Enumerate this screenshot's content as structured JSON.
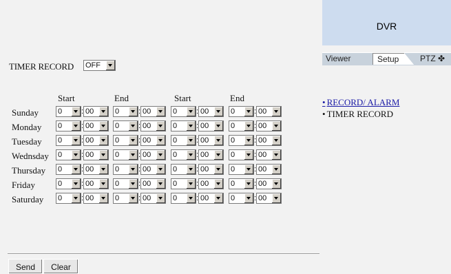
{
  "timer_record": {
    "label": "TIMER RECORD",
    "value": "OFF"
  },
  "headers": [
    "Start",
    "End",
    "Start",
    "End"
  ],
  "days": [
    "Sunday",
    "Monday",
    "Tuesday",
    "Wednsday",
    "Thursday",
    "Friday",
    "Saturday"
  ],
  "default_hour": "0",
  "default_minute": "00",
  "colon": ":",
  "buttons": {
    "send": "Send",
    "clear": "Clear"
  },
  "panel": {
    "title": "DVR",
    "tabs": {
      "viewer": "Viewer",
      "setup": "Setup",
      "ptz": "PTZ ✤"
    },
    "menu": [
      {
        "bullet": "•",
        "label": "RECORD/ ALARM",
        "link": true
      },
      {
        "bullet": "•",
        "label": "TIMER RECORD",
        "link": false
      }
    ]
  },
  "colors": {
    "panel_header": "#cddcef",
    "link": "#1a1aa6",
    "background": "#f2f2f2"
  }
}
